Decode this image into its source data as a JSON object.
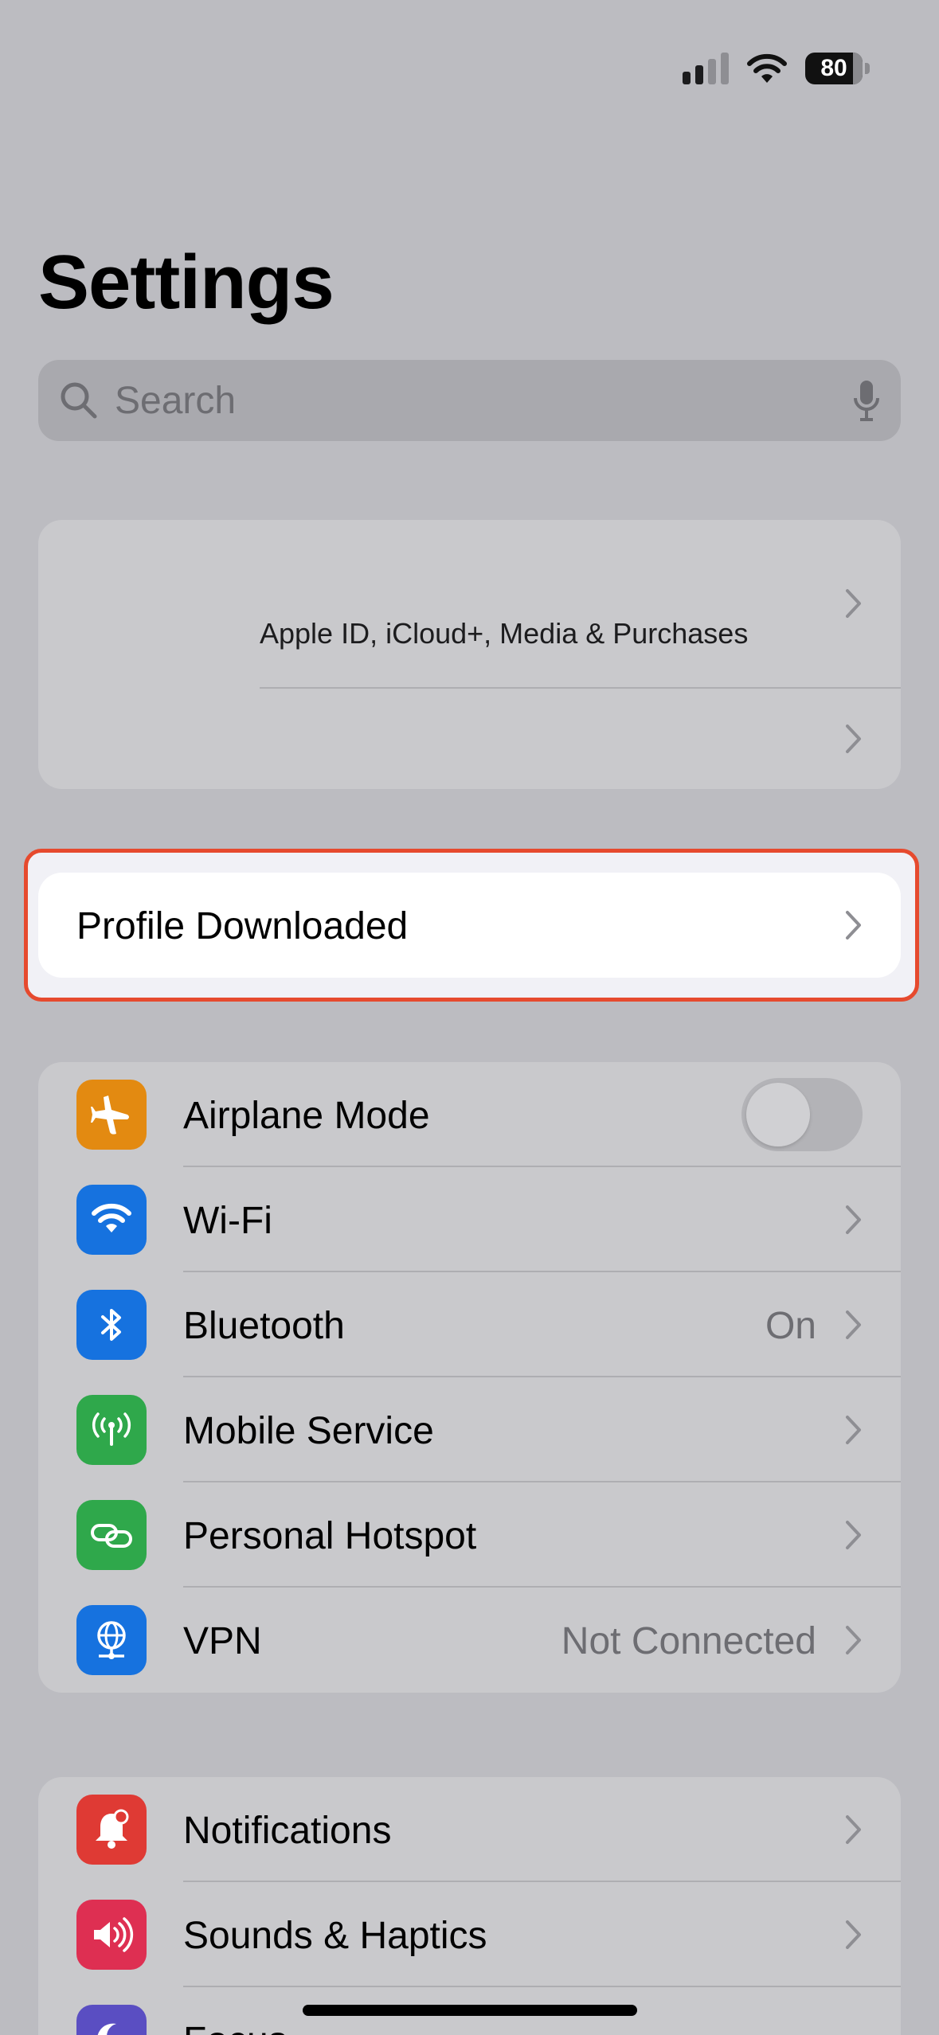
{
  "status_bar": {
    "battery": "80"
  },
  "page_title": "Settings",
  "search": {
    "placeholder": "Search"
  },
  "account": {
    "subtitle": "Apple ID, iCloud+, Media & Purchases"
  },
  "profile_banner": {
    "label": "Profile Downloaded"
  },
  "connectivity": [
    {
      "label": "Airplane Mode",
      "icon": "airplane-icon",
      "color": "#e38a11",
      "toggle": false
    },
    {
      "label": "Wi-Fi",
      "icon": "wifi-icon",
      "color": "#1672df",
      "value": ""
    },
    {
      "label": "Bluetooth",
      "icon": "bluetooth-icon",
      "color": "#1672df",
      "value": "On"
    },
    {
      "label": "Mobile Service",
      "icon": "antenna-icon",
      "color": "#2fa84b",
      "value": ""
    },
    {
      "label": "Personal Hotspot",
      "icon": "hotspot-icon",
      "color": "#2fa84b",
      "value": ""
    },
    {
      "label": "VPN",
      "icon": "globe-icon",
      "color": "#1672df",
      "value": "Not Connected"
    }
  ],
  "notifications_group": [
    {
      "label": "Notifications",
      "icon": "bell-icon",
      "color": "#df3a34"
    },
    {
      "label": "Sounds & Haptics",
      "icon": "speaker-icon",
      "color": "#de2f52"
    },
    {
      "label": "Focus",
      "icon": "moon-icon",
      "color": "#5a4ec2"
    }
  ]
}
